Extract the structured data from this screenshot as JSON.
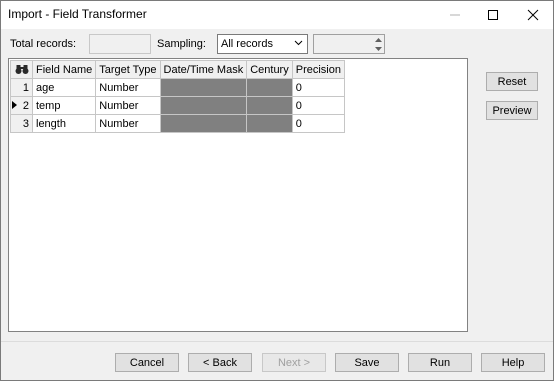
{
  "window": {
    "title": "Import - Field Transformer"
  },
  "filters": {
    "total_records_label": "Total records:",
    "total_records_value": "",
    "sampling_label": "Sampling:",
    "sampling_value": "All records",
    "sampling_count_value": ""
  },
  "grid": {
    "corner_icon": "binoculars-icon",
    "columns": [
      "Field Name",
      "Target Type",
      "Date/Time Mask",
      "Century",
      "Precision"
    ],
    "rows": [
      {
        "num": "1",
        "field_name": "age",
        "target_type": "Number",
        "datetime_mask": "",
        "century": "",
        "precision": "0"
      },
      {
        "num": "2",
        "field_name": "temp",
        "target_type": "Number",
        "datetime_mask": "",
        "century": "",
        "precision": "0"
      },
      {
        "num": "3",
        "field_name": "length",
        "target_type": "Number",
        "datetime_mask": "",
        "century": "",
        "precision": "0"
      }
    ]
  },
  "side_buttons": {
    "reset": "Reset",
    "preview": "Preview"
  },
  "footer_buttons": {
    "cancel": "Cancel",
    "back": "< Back",
    "next": "Next >",
    "save": "Save",
    "run": "Run",
    "help": "Help"
  },
  "colors": {
    "disabled_cell": "#808080",
    "window_bg": "#f0f0f0"
  }
}
